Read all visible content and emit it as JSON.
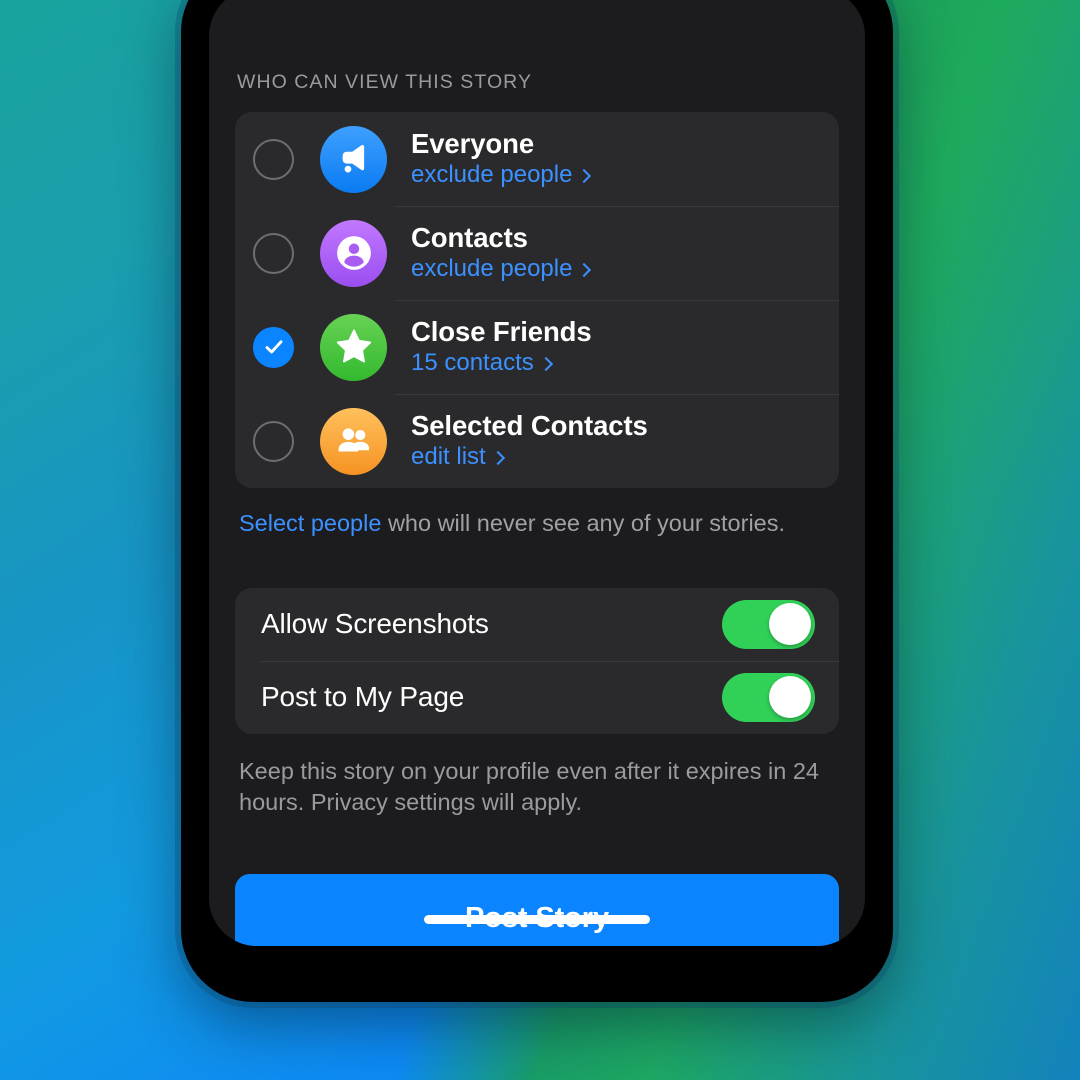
{
  "screen": {
    "section_header": "WHO CAN VIEW THIS STORY",
    "audience_options": [
      {
        "title": "Everyone",
        "sub": "exclude people",
        "icon": "megaphone-icon",
        "icon_color": "#0a7bf2",
        "selected": false
      },
      {
        "title": "Contacts",
        "sub": "exclude people",
        "icon": "person-circle-icon",
        "icon_color": "#9b4ef0",
        "selected": false
      },
      {
        "title": "Close Friends",
        "sub": "15 contacts",
        "icon": "star-icon",
        "icon_color": "#34b92f",
        "selected": true
      },
      {
        "title": "Selected Contacts",
        "sub": "edit list",
        "icon": "people-group-icon",
        "icon_color": "#f59323",
        "selected": false
      }
    ],
    "footnote": {
      "link": "Select people",
      "rest": " who will never see any of your stories."
    },
    "toggles": [
      {
        "label": "Allow Screenshots",
        "on": true
      },
      {
        "label": "Post to My Page",
        "on": true
      }
    ],
    "caption": "Keep this story on your profile even after it expires in 24 hours. Privacy settings will apply.",
    "cta_label": "Post Story"
  },
  "colors": {
    "accent_blue": "#0a84ff",
    "link_blue": "#3b91ff",
    "toggle_green": "#31d158",
    "screen_bg": "#1c1c1e",
    "card_bg": "#2a2a2c",
    "divider": "#3a3a3c",
    "secondary_text": "#9a9a9f"
  }
}
